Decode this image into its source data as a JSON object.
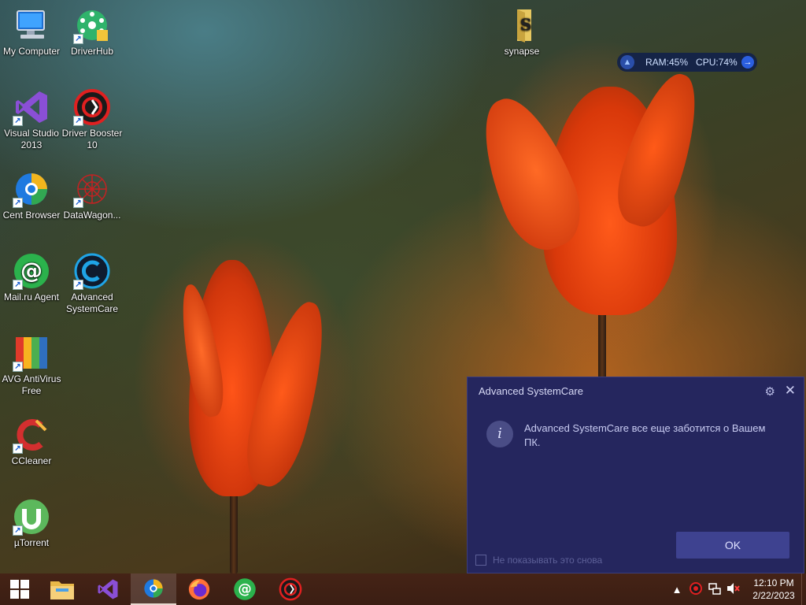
{
  "desktop": {
    "icons": [
      {
        "label": "My Computer",
        "icon": "computer-icon"
      },
      {
        "label": "DriverHub",
        "icon": "driverhub-icon"
      },
      {
        "label": "Visual Studio 2013",
        "icon": "visual-studio-icon"
      },
      {
        "label": "Driver Booster 10",
        "icon": "driver-booster-icon"
      },
      {
        "label": "Cent Browser",
        "icon": "cent-browser-icon"
      },
      {
        "label": "DataWagon...",
        "icon": "datawagon-icon"
      },
      {
        "label": "Mail.ru Agent",
        "icon": "mailru-agent-icon"
      },
      {
        "label": "Advanced SystemCare",
        "icon": "advanced-systemcare-icon"
      },
      {
        "label": "AVG AntiVirus Free",
        "icon": "avg-antivirus-icon"
      },
      {
        "label": "CCleaner",
        "icon": "ccleaner-icon"
      },
      {
        "label": "µTorrent",
        "icon": "utorrent-icon"
      },
      {
        "label": "synapse",
        "icon": "folder-icon"
      }
    ]
  },
  "monitor_widget": {
    "ram_label": "RAM:45%",
    "cpu_label": "CPU:74%"
  },
  "dialog": {
    "title": "Advanced SystemCare",
    "message": "Advanced SystemCare все еще заботится о Вашем ПК.",
    "ok_label": "OK",
    "dont_show_label": "Не показывать это снова",
    "dont_show_checked": false
  },
  "taskbar": {
    "apps": [
      "windows-start-icon",
      "file-explorer-icon",
      "visual-studio-icon",
      "cent-browser-icon",
      "firefox-icon",
      "mailru-agent-icon",
      "driver-booster-icon"
    ],
    "active_app": "cent-browser-icon",
    "clock_time": "12:10 PM",
    "clock_date": "2/22/2023"
  },
  "colors": {
    "dialog_bg": "#25265e",
    "ok_button": "#3e4290",
    "taskbar_bg": "#452316"
  }
}
